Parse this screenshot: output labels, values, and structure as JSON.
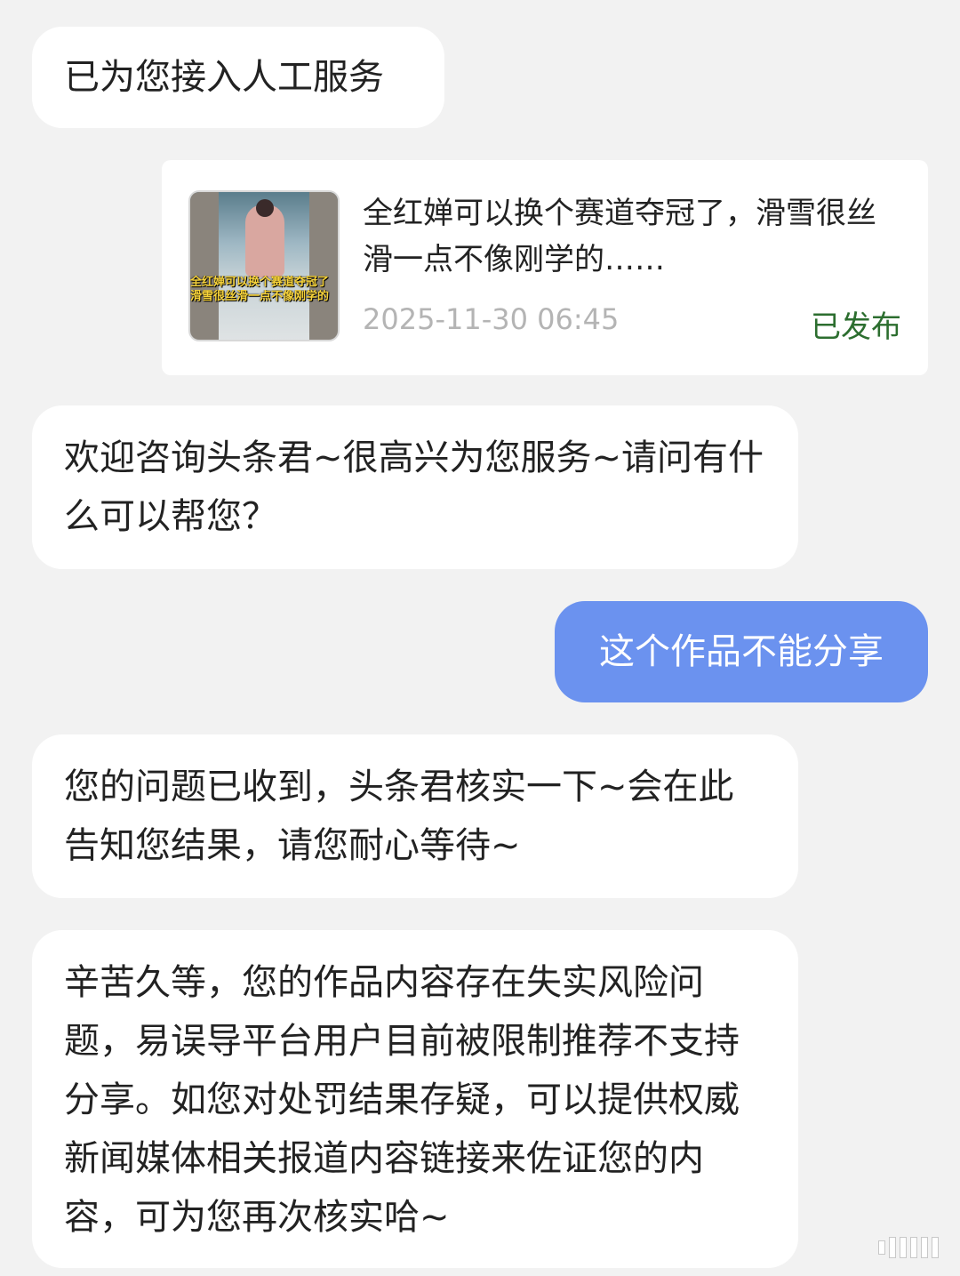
{
  "messages": {
    "m1": "已为您接入人工服务",
    "card": {
      "title": "全红婵可以换个赛道夺冠了，滑雪很丝滑一点不像刚学的……",
      "date": "2025-11-30 06:45",
      "status": "已发布",
      "thumb_caption_1": "全红婵可以换个赛道夺冠了",
      "thumb_caption_2": "滑雪很丝滑一点不像刚学的"
    },
    "m3": "欢迎咨询头条君~很高兴为您服务~请问有什么可以帮您？",
    "user": "这个作品不能分享",
    "m5": "您的问题已收到，头条君核实一下~会在此告知您结果，请您耐心等待~",
    "m6": "辛苦久等，您的作品内容存在失实风险问题，易误导平台用户目前被限制推荐不支持分享。如您对处罚结果存疑，可以提供权威新闻媒体相关报道内容链接来佐证您的内容，可为您再次核实哈~"
  },
  "colors": {
    "background": "#f2f2f2",
    "user_bubble": "#6b92ef",
    "status_green": "#2c6e2f",
    "date_gray": "#b4b4b4"
  }
}
